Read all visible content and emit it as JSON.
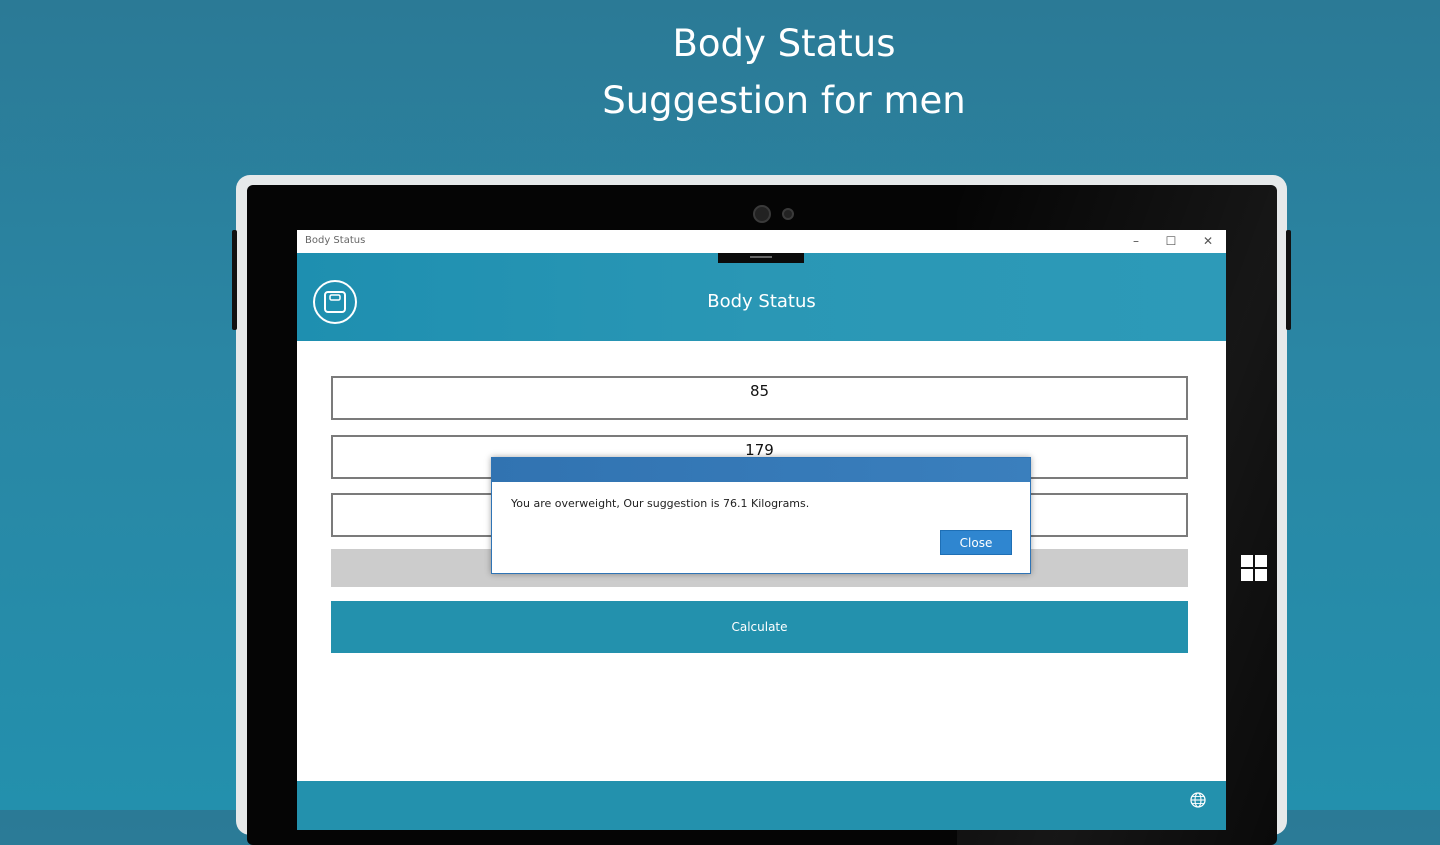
{
  "promo": {
    "line1": "Body Status",
    "line2": "Suggestion for men"
  },
  "window": {
    "title": "Body Status",
    "controls": {
      "minimize": "–",
      "maximize": "☐",
      "close": "✕"
    }
  },
  "header": {
    "title": "Body Status",
    "logo_icon": "scale-icon"
  },
  "form": {
    "field1_value": "85",
    "field2_value": "179",
    "field3_value": "",
    "calculate_label": "Calculate"
  },
  "dialog": {
    "message": "You are overweight, Our suggestion is 76.1 Kilograms.",
    "close_label": "Close"
  },
  "footer": {
    "icon": "globe-icon"
  },
  "colors": {
    "background": "#2a86a4",
    "header": "#2391ad",
    "dialog_header": "#3173b1",
    "dialog_button": "#2f86d0"
  }
}
